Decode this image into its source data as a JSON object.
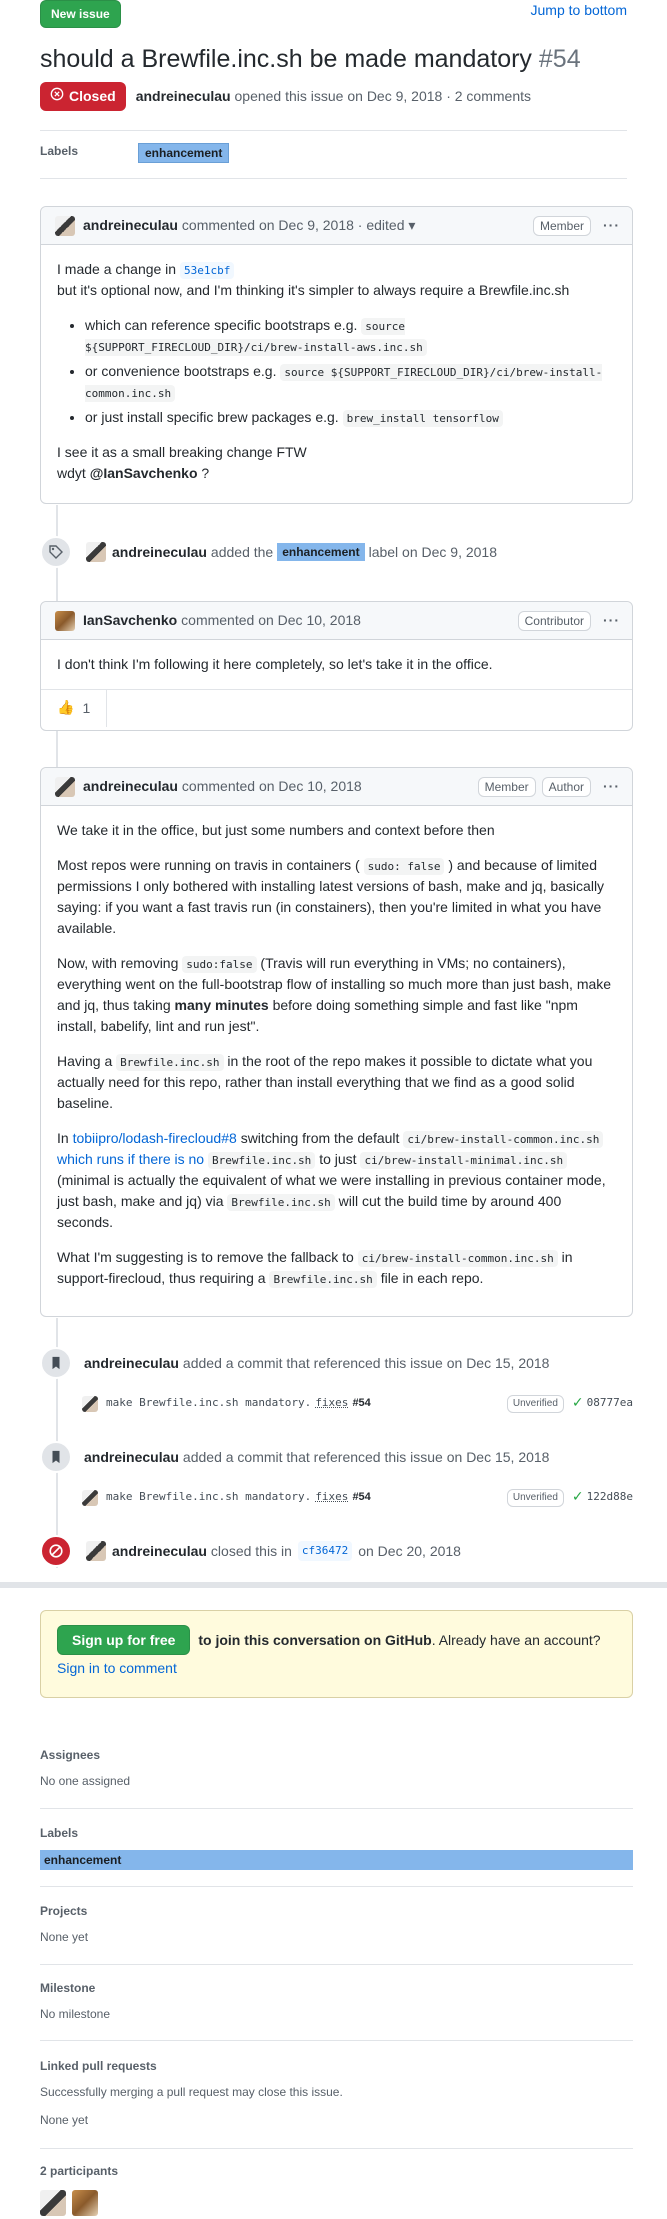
{
  "header": {
    "new_issue": "New issue",
    "jump_to_bottom": "Jump to bottom",
    "title": "should a Brewfile.inc.sh be made mandatory",
    "number": "#54",
    "state": "Closed",
    "author": "andreineculau",
    "opened_text": "opened this issue on Dec 9, 2018 · 2 comments",
    "labels_heading": "Labels",
    "label": "enhancement"
  },
  "comment1": {
    "author": "andreineculau",
    "meta": "commented on Dec 9, 2018 · edited ▾",
    "role": "Member",
    "p1_a": "I made a change in",
    "p1_sha": "53e1cbf",
    "p1_b": "but it's optional now, and I'm thinking it's simpler to always require a Brewfile.inc.sh",
    "li1_a": "which can reference specific bootstraps e.g.",
    "li1_code": "source ${SUPPORT_FIRECLOUD_DIR}/ci/brew-install-aws.inc.sh",
    "li2_a": "or convenience bootstraps e.g.",
    "li2_code": "source ${SUPPORT_FIRECLOUD_DIR}/ci/brew-install-common.inc.sh",
    "li3_a": "or just install specific brew packages e.g.",
    "li3_code": "brew_install tensorflow",
    "p2": "I see it as a small breaking change FTW",
    "p3_a": "wdyt",
    "p3_mention": "@IanSavchenko",
    "p3_b": "?"
  },
  "event_label": {
    "author": "andreineculau",
    "text_a": "added the",
    "label": "enhancement",
    "text_b": "label on Dec 9, 2018"
  },
  "comment2": {
    "author": "IanSavchenko",
    "meta": "commented on Dec 10, 2018",
    "role": "Contributor",
    "body": "I don't think I'm following it here completely, so let's take it in the office.",
    "reaction_emoji": "👍",
    "reaction_count": "1"
  },
  "comment3": {
    "author": "andreineculau",
    "meta": "commented on Dec 10, 2018",
    "role1": "Member",
    "role2": "Author",
    "p1": "We take it in the office, but just some numbers and context before then",
    "p2_a": "Most repos were running on travis in containers (",
    "p2_code": "sudo: false",
    "p2_b": ") and because of limited permissions I only bothered with installing latest versions of bash, make and jq, basically saying: if you want a fast travis run (in constainers), then you're limited in what you have available.",
    "p3_a": "Now, with removing",
    "p3_code": "sudo:false",
    "p3_b": "(Travis will run everything in VMs; no containers), everything went on the full-bootstrap flow of installing so much more than just bash, make and jq, thus taking",
    "p3_strong": "many minutes",
    "p3_c": "before doing something simple and fast like \"npm install, babelify, lint and run jest\".",
    "p4_a": "Having a",
    "p4_code": "Brewfile.inc.sh",
    "p4_b": "in the root of the repo makes it possible to dictate what you actually need for this repo, rather than install everything that we find as a good solid baseline.",
    "p5_a": "In",
    "p5_link": "tobiipro/lodash-firecloud#8",
    "p5_b": "switching from the default",
    "p5_code1": "ci/brew-install-common.inc.sh",
    "p5_link2": "which runs if there is no",
    "p5_code2": "Brewfile.inc.sh",
    "p5_c": "to just",
    "p5_code3": "ci/brew-install-minimal.inc.sh",
    "p5_d": "(minimal is actually the equivalent of what we were installing in previous container mode, just bash, make and jq) via",
    "p5_code4": "Brewfile.inc.sh",
    "p5_e": "will cut the build time by around 400 seconds.",
    "p6_a": "What I'm suggesting is to remove the fallback to",
    "p6_code1": "ci/brew-install-common.inc.sh",
    "p6_b": "in support-firecloud, thus requiring a",
    "p6_code2": "Brewfile.inc.sh",
    "p6_c": "file in each repo."
  },
  "commit_events": [
    {
      "author": "andreineculau",
      "text": "added a commit that referenced this issue on Dec 15, 2018",
      "msg": "make Brewfile.inc.sh mandatory.",
      "fixes": "fixes",
      "ref": "#54",
      "verified": "Unverified",
      "sha": "08777ea"
    },
    {
      "author": "andreineculau",
      "text": "added a commit that referenced this issue on Dec 15, 2018",
      "msg": "make Brewfile.inc.sh mandatory.",
      "fixes": "fixes",
      "ref": "#54",
      "verified": "Unverified",
      "sha": "122d88e"
    }
  ],
  "close_event": {
    "author": "andreineculau",
    "text_a": "closed this in",
    "sha": "cf36472",
    "text_b": "on Dec 20, 2018"
  },
  "signup": {
    "button": "Sign up for free",
    "text_strong": "to join this conversation on GitHub",
    "text": ". Already have an account?",
    "link": "Sign in to comment"
  },
  "sidebar": {
    "assignees_heading": "Assignees",
    "assignees_value": "No one assigned",
    "labels_heading": "Labels",
    "label": "enhancement",
    "projects_heading": "Projects",
    "projects_value": "None yet",
    "milestone_heading": "Milestone",
    "milestone_value": "No milestone",
    "linked_heading": "Linked pull requests",
    "linked_note": "Successfully merging a pull request may close this issue.",
    "linked_value": "None yet",
    "participants_heading": "2 participants"
  },
  "colors": {
    "closed": "#cb2431",
    "green": "#2ea44f",
    "label": "#84b6eb",
    "link": "#0366d6"
  }
}
